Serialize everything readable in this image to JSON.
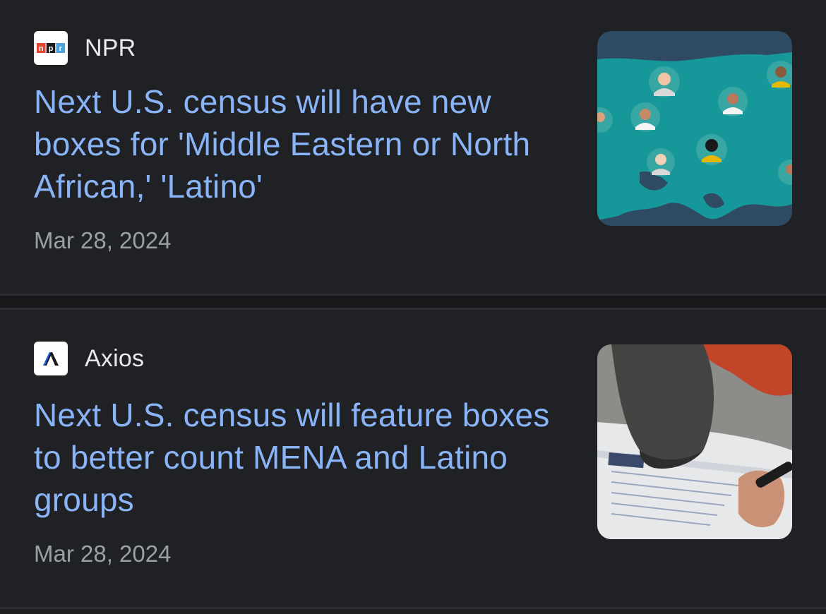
{
  "articles": [
    {
      "source": "NPR",
      "logo_text": "npr",
      "headline": "Next U.S. census will have new boxes for 'Middle Eastern or North African,' 'Latino'",
      "date": "Mar 28, 2024"
    },
    {
      "source": "Axios",
      "logo_text": "Λ",
      "headline": "Next U.S. census will feature boxes to better count MENA and Latino groups",
      "date": "Mar 28, 2024"
    }
  ],
  "colors": {
    "background": "#202124",
    "headline": "#8ab4f8",
    "source": "#e8eaed",
    "date": "#9aa0a6",
    "npr_red": "#e6462f",
    "npr_black": "#1a1a1a",
    "npr_blue": "#4aa3df",
    "axios_blue": "#1a5fd6"
  }
}
